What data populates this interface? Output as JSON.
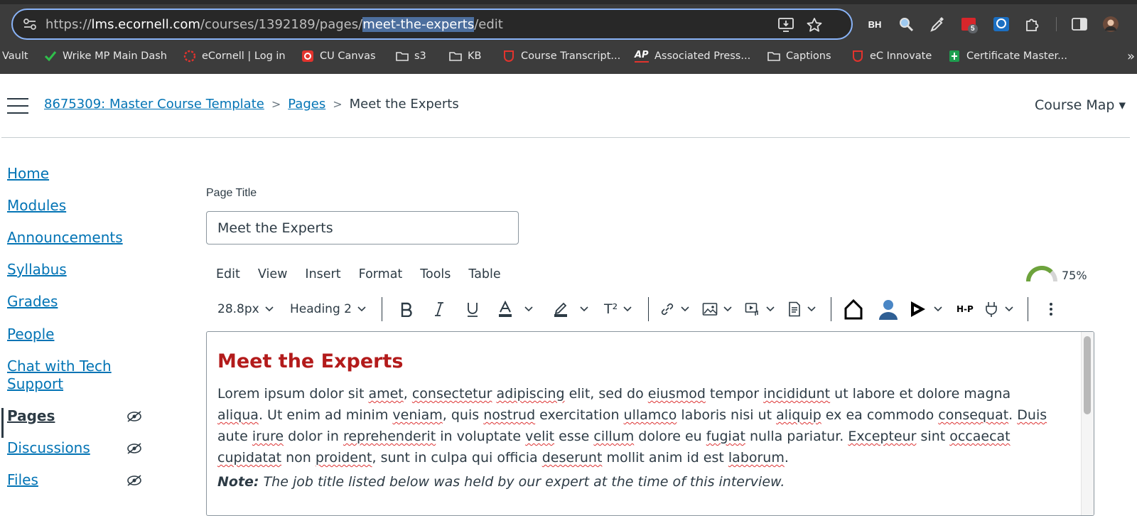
{
  "browser": {
    "url_prefix": "https://",
    "url_host": "lms.ecornell.com",
    "url_path_before": "/courses/1392189/pages/",
    "url_path_selected": "meet-the-experts",
    "url_path_after": "/edit",
    "extensions": [
      {
        "name": "bh-extension",
        "label": "BH"
      },
      {
        "name": "badge-extension",
        "label": "5"
      }
    ],
    "bookmarks": [
      {
        "label": "Vault",
        "icon": "none"
      },
      {
        "label": "Wrike MP Main Dash",
        "icon": "checkmark-icon"
      },
      {
        "label": "eCornell | Log in",
        "icon": "ecornell-icon"
      },
      {
        "label": "CU Canvas",
        "icon": "canvas-icon"
      },
      {
        "label": "s3",
        "icon": "folder-icon"
      },
      {
        "label": "KB",
        "icon": "folder-icon"
      },
      {
        "label": "Course Transcript...",
        "icon": "shield-icon"
      },
      {
        "label": "Associated Press...",
        "icon": "ap-icon"
      },
      {
        "label": "Captions",
        "icon": "folder-icon"
      },
      {
        "label": "eC Innovate",
        "icon": "shield-icon"
      },
      {
        "label": "Certificate Master...",
        "icon": "sheets-icon"
      }
    ],
    "ap_logo_text": "AP",
    "more_bookmarks": "»"
  },
  "header": {
    "breadcrumbs": [
      "8675309: Master Course Template",
      "Pages",
      "Meet the Experts"
    ],
    "separator": ">",
    "course_map": "Course Map ▾"
  },
  "nav": {
    "items": [
      {
        "label": "Home",
        "hidden": false,
        "active": false
      },
      {
        "label": "Modules",
        "hidden": false,
        "active": false
      },
      {
        "label": "Announcements",
        "hidden": false,
        "active": false
      },
      {
        "label": "Syllabus",
        "hidden": false,
        "active": false
      },
      {
        "label": "Grades",
        "hidden": false,
        "active": false
      },
      {
        "label": "People",
        "hidden": false,
        "active": false
      },
      {
        "label": "Chat with Tech",
        "hidden": false,
        "active": false
      },
      {
        "label": "Support",
        "hidden": false,
        "active": false
      },
      {
        "label": "Pages",
        "hidden": true,
        "active": true
      },
      {
        "label": "Discussions",
        "hidden": true,
        "active": false
      },
      {
        "label": "Files",
        "hidden": true,
        "active": false
      }
    ]
  },
  "editor": {
    "page_title_label": "Page Title",
    "page_title_value": "Meet the Experts",
    "menus": [
      "Edit",
      "View",
      "Insert",
      "Format",
      "Tools",
      "Table"
    ],
    "accessibility_percent": "75%",
    "accessibility_value": 0.75,
    "font_size": "28.8px",
    "block_format": "Heading 2",
    "superscript_label": "T²",
    "h5p_label": "H-P",
    "content": {
      "heading": "Meet the Experts",
      "paragraph": [
        {
          "t": "Lorem ipsum dolor sit ",
          "s": false
        },
        {
          "t": "amet",
          "s": true
        },
        {
          "t": ", ",
          "s": false
        },
        {
          "t": "consectetur",
          "s": true
        },
        {
          "t": " ",
          "s": false
        },
        {
          "t": "adipiscing",
          "s": true
        },
        {
          "t": " elit, sed do ",
          "s": false
        },
        {
          "t": "eiusmod",
          "s": true
        },
        {
          "t": " tempor ",
          "s": false
        },
        {
          "t": "incididunt",
          "s": true
        },
        {
          "t": " ut labore et dolore magna ",
          "s": false
        },
        {
          "t": "aliqua",
          "s": true
        },
        {
          "t": ". Ut enim ad minim ",
          "s": false
        },
        {
          "t": "veniam",
          "s": true
        },
        {
          "t": ", quis ",
          "s": false
        },
        {
          "t": "nostrud",
          "s": true
        },
        {
          "t": " exercitation ",
          "s": false
        },
        {
          "t": "ullamco",
          "s": true
        },
        {
          "t": " laboris nisi ut ",
          "s": false
        },
        {
          "t": "aliquip",
          "s": true
        },
        {
          "t": " ex ea commodo ",
          "s": false
        },
        {
          "t": "consequat",
          "s": true
        },
        {
          "t": ". ",
          "s": false
        },
        {
          "t": "Duis",
          "s": true
        },
        {
          "t": " aute ",
          "s": false
        },
        {
          "t": "irure",
          "s": true
        },
        {
          "t": " dolor in ",
          "s": false
        },
        {
          "t": "reprehenderit",
          "s": true
        },
        {
          "t": " in voluptate ",
          "s": false
        },
        {
          "t": "velit",
          "s": true
        },
        {
          "t": " esse ",
          "s": false
        },
        {
          "t": "cillum",
          "s": true
        },
        {
          "t": " dolore eu ",
          "s": false
        },
        {
          "t": "fugiat",
          "s": true
        },
        {
          "t": " nulla pariatur. ",
          "s": false
        },
        {
          "t": "Excepteur",
          "s": true
        },
        {
          "t": " sint ",
          "s": false
        },
        {
          "t": "occaecat",
          "s": true
        },
        {
          "t": " ",
          "s": false
        },
        {
          "t": "cupidatat",
          "s": true
        },
        {
          "t": " non ",
          "s": false
        },
        {
          "t": "proident",
          "s": true
        },
        {
          "t": ", sunt in culpa qui officia ",
          "s": false
        },
        {
          "t": "deserunt",
          "s": true
        },
        {
          "t": " mollit anim id est ",
          "s": false
        },
        {
          "t": "laborum",
          "s": true
        },
        {
          "t": ".",
          "s": false
        }
      ],
      "note_label": "Note:",
      "note_text": " The job title listed below was held by our expert at the time of this interview."
    }
  },
  "colors": {
    "link": "#0374b5",
    "text": "#2d3b45",
    "heading": "#b31b1b",
    "gauge": "#6da33c"
  }
}
